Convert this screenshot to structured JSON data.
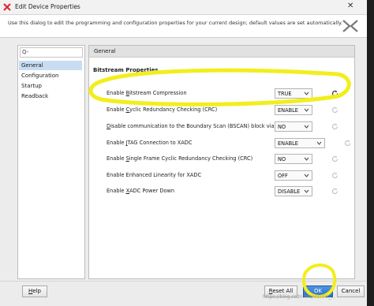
{
  "window": {
    "title": "Edit Device Properties"
  },
  "description": "Use this dialog to edit the programming and configuration properties for your current design; default values are set automatically.",
  "search": {
    "placeholder": "Q-"
  },
  "nav": [
    {
      "label": "General",
      "selected": true
    },
    {
      "label": "Configuration",
      "selected": false
    },
    {
      "label": "Startup",
      "selected": false
    },
    {
      "label": "Readback",
      "selected": false
    }
  ],
  "panel": {
    "header": "General",
    "section": "Bitstream Properties"
  },
  "properties": [
    {
      "pre": "Enable ",
      "u": "B",
      "post": "itstream Compression",
      "value": "TRUE",
      "modified": true
    },
    {
      "pre": "Enable ",
      "u": "C",
      "post": "yclic Redundancy Checking (CRC)",
      "value": "ENABLE",
      "modified": false
    },
    {
      "pre": "",
      "u": "D",
      "post": "isable communication to the Boundary Scan (BSCAN) block via JTAG",
      "value": "NO",
      "modified": false
    },
    {
      "pre": "Enable ",
      "u": "J",
      "post": "TAG Connection to XADC",
      "value": "ENABLE",
      "modified": false
    },
    {
      "pre": "Enable ",
      "u": "S",
      "post": "ingle Frame Cyclic Redundancy Checking (CRC)",
      "value": "NO",
      "modified": false
    },
    {
      "pre": "Enable Enhanced Linearity for XADC",
      "u": "",
      "post": "",
      "value": "OFF",
      "modified": false
    },
    {
      "pre": "Enable ",
      "u": "X",
      "post": "ADC Power Down",
      "value": "DISABLE",
      "modified": false
    }
  ],
  "buttons": {
    "help_u": "H",
    "help_rest": "elp",
    "reset_u": "R",
    "reset_rest": "eset All",
    "ok": "OK",
    "cancel": "Cancel"
  },
  "watermark": "https://blog.csdn.net/weixin_...",
  "colors": {
    "highlight": "#f2ee1c",
    "selection": "#c8ddf2",
    "primary": "#3a7fd5"
  }
}
